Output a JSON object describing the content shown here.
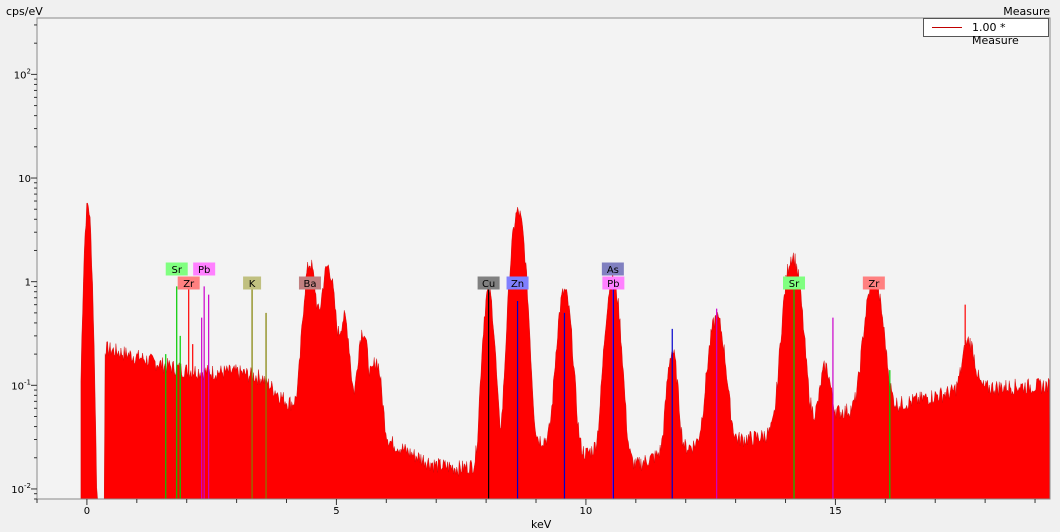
{
  "header": {
    "y_unit": "cps/eV",
    "measure_title": "Measure"
  },
  "legend": {
    "label": "1.00 * Measure",
    "color": "#c00000"
  },
  "chart_data": {
    "type": "area",
    "xlabel": "keV",
    "ylabel": "cps/eV",
    "yscale": "log",
    "xlim": [
      -1,
      19.3
    ],
    "ylim": [
      0.008,
      350
    ],
    "x_ticks": [
      0,
      5,
      10,
      15
    ],
    "x_tick_labels": [
      "0",
      "5",
      "10",
      "15"
    ],
    "y_ticks": [
      0.01,
      0.1,
      1,
      10,
      100
    ],
    "y_tick_labels": [
      "10-2",
      "10-1",
      "1",
      "10",
      "102"
    ],
    "fill_color": "#ff0000",
    "plot_background": "#f3f3f3",
    "legend_position": "top-right",
    "series": [
      {
        "name": "1.00 * Measure",
        "baseline_points": [
          [
            0.35,
            0.23
          ],
          [
            0.5,
            0.22
          ],
          [
            1.0,
            0.19
          ],
          [
            1.5,
            0.16
          ],
          [
            2.0,
            0.14
          ],
          [
            2.5,
            0.135
          ],
          [
            3.0,
            0.135
          ],
          [
            3.5,
            0.12
          ],
          [
            4.0,
            0.07
          ],
          [
            4.6,
            0.06
          ],
          [
            5.5,
            0.04
          ],
          [
            6.0,
            0.03
          ],
          [
            6.5,
            0.022
          ],
          [
            7.0,
            0.017
          ],
          [
            7.5,
            0.016
          ],
          [
            8.0,
            0.018
          ],
          [
            8.5,
            0.028
          ],
          [
            9.0,
            0.03
          ],
          [
            9.5,
            0.03
          ],
          [
            10.0,
            0.022
          ],
          [
            10.5,
            0.03
          ],
          [
            11.0,
            0.017
          ],
          [
            11.5,
            0.022
          ],
          [
            12.0,
            0.025
          ],
          [
            12.5,
            0.03
          ],
          [
            13.0,
            0.03
          ],
          [
            13.5,
            0.032
          ],
          [
            14.0,
            0.04
          ],
          [
            14.5,
            0.05
          ],
          [
            15.0,
            0.055
          ],
          [
            15.5,
            0.06
          ],
          [
            16.0,
            0.062
          ],
          [
            16.5,
            0.07
          ],
          [
            17.0,
            0.08
          ],
          [
            17.5,
            0.09
          ],
          [
            18.0,
            0.095
          ],
          [
            18.5,
            0.098
          ],
          [
            19.2,
            0.1
          ]
        ],
        "peaks": [
          {
            "energy": 0.02,
            "height": 5.6,
            "width": 0.05
          },
          {
            "energy": 4.47,
            "height": 1.45,
            "width": 0.09
          },
          {
            "energy": 4.83,
            "height": 1.35,
            "width": 0.1
          },
          {
            "energy": 5.16,
            "height": 0.4,
            "width": 0.08
          },
          {
            "energy": 5.53,
            "height": 0.3,
            "width": 0.08
          },
          {
            "energy": 5.8,
            "height": 0.14,
            "width": 0.08
          },
          {
            "energy": 8.05,
            "height": 0.8,
            "width": 0.08
          },
          {
            "energy": 8.64,
            "height": 4.7,
            "width": 0.1
          },
          {
            "energy": 9.57,
            "height": 0.78,
            "width": 0.1
          },
          {
            "energy": 10.54,
            "height": 1.05,
            "width": 0.1
          },
          {
            "energy": 11.73,
            "height": 0.19,
            "width": 0.08
          },
          {
            "energy": 12.62,
            "height": 0.42,
            "width": 0.12
          },
          {
            "energy": 14.14,
            "height": 1.75,
            "width": 0.12
          },
          {
            "energy": 14.8,
            "height": 0.1,
            "width": 0.08
          },
          {
            "energy": 15.77,
            "height": 0.95,
            "width": 0.13
          },
          {
            "energy": 17.67,
            "height": 0.18,
            "width": 0.1
          }
        ]
      }
    ],
    "element_lines": [
      {
        "energy": 1.58,
        "height": 0.2,
        "color": "#00cc00"
      },
      {
        "energy": 1.8,
        "height": 0.9,
        "color": "#00cc00"
      },
      {
        "energy": 1.87,
        "height": 0.3,
        "color": "#00cc00"
      },
      {
        "energy": 2.04,
        "height": 0.9,
        "color": "#ff0000"
      },
      {
        "energy": 2.12,
        "height": 0.25,
        "color": "#ff0000"
      },
      {
        "energy": 2.3,
        "height": 0.45,
        "color": "#cc00cc"
      },
      {
        "energy": 2.35,
        "height": 0.9,
        "color": "#cc00cc"
      },
      {
        "energy": 2.44,
        "height": 0.75,
        "color": "#cc00cc"
      },
      {
        "energy": 3.31,
        "height": 0.9,
        "color": "#808000"
      },
      {
        "energy": 3.59,
        "height": 0.5,
        "color": "#808000"
      },
      {
        "energy": 4.47,
        "height": 0.9,
        "color": "#ff0000"
      },
      {
        "energy": 8.05,
        "height": 0.9,
        "color": "#000000"
      },
      {
        "energy": 8.63,
        "height": 0.65,
        "color": "#0000cc"
      },
      {
        "energy": 9.57,
        "height": 0.5,
        "color": "#0000cc"
      },
      {
        "energy": 10.54,
        "height": 0.9,
        "color": "#cc00cc"
      },
      {
        "energy": 10.55,
        "height": 0.9,
        "color": "#0000cc"
      },
      {
        "energy": 11.73,
        "height": 0.35,
        "color": "#0000cc"
      },
      {
        "energy": 12.62,
        "height": 0.55,
        "color": "#cc00cc"
      },
      {
        "energy": 14.17,
        "height": 0.9,
        "color": "#00cc00"
      },
      {
        "energy": 14.95,
        "height": 0.45,
        "color": "#cc00cc"
      },
      {
        "energy": 15.77,
        "height": 0.9,
        "color": "#ff0000"
      },
      {
        "energy": 16.09,
        "height": 0.14,
        "color": "#00cc00"
      },
      {
        "energy": 17.6,
        "height": 0.6,
        "color": "#ff0000"
      }
    ],
    "element_labels": [
      {
        "text": "Sr",
        "energy": 1.8,
        "row": 1,
        "color": "#80ff80"
      },
      {
        "text": "Pb",
        "energy": 2.35,
        "row": 1,
        "color": "#ff80ff"
      },
      {
        "text": "Zr",
        "energy": 2.04,
        "row": 0,
        "color": "#ff8080"
      },
      {
        "text": "K",
        "energy": 3.31,
        "row": 0,
        "color": "#c0c080"
      },
      {
        "text": "Ba",
        "energy": 4.47,
        "row": 0,
        "color": "#c08080"
      },
      {
        "text": "Cu",
        "energy": 8.05,
        "row": 0,
        "color": "#808080"
      },
      {
        "text": "Zn",
        "energy": 8.63,
        "row": 0,
        "color": "#8080ff"
      },
      {
        "text": "As",
        "energy": 10.54,
        "row": 1,
        "color": "#8080c0"
      },
      {
        "text": "Pb",
        "energy": 10.55,
        "row": 0,
        "color": "#ff80ff"
      },
      {
        "text": "Sr",
        "energy": 14.17,
        "row": 0,
        "color": "#80ff80"
      },
      {
        "text": "Zr",
        "energy": 15.77,
        "row": 0,
        "color": "#ff8080"
      }
    ]
  }
}
